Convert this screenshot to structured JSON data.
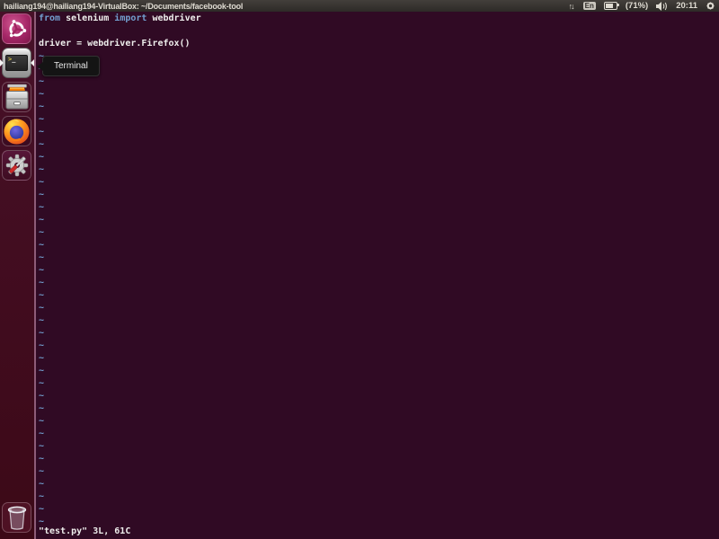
{
  "panel": {
    "title": "hailiang194@hailiang194-VirtualBox: ~/Documents/facebook-tool",
    "keyboard_layout": "En",
    "battery_percent": "(71%)",
    "clock": "20:11",
    "network_icon": "updown-arrows-icon",
    "battery_icon": "battery-icon",
    "volume_icon": "speaker-icon",
    "session_icon": "gear-icon"
  },
  "launcher": {
    "items": [
      {
        "name": "ubuntu-dash",
        "icon": "ubuntu-logo-icon"
      },
      {
        "name": "terminal",
        "icon": "terminal-icon",
        "running": true,
        "focused": true
      },
      {
        "name": "files",
        "icon": "file-cabinet-icon"
      },
      {
        "name": "firefox",
        "icon": "firefox-icon"
      },
      {
        "name": "settings",
        "icon": "gear-tools-icon"
      },
      {
        "name": "trash",
        "icon": "trash-icon"
      }
    ]
  },
  "tooltip": {
    "text": "Terminal"
  },
  "terminal": {
    "line1_tokens": [
      {
        "text": "from ",
        "type": "keyword"
      },
      {
        "text": "selenium ",
        "type": "plain"
      },
      {
        "text": "import ",
        "type": "keyword"
      },
      {
        "text": "webdriver",
        "type": "plain"
      }
    ],
    "line2": "",
    "line3": "driver = webdriver.Firefox()",
    "tilde": "~",
    "tilde_count": 38,
    "status_line": "\"test.py\" 3L, 61C"
  },
  "colors": {
    "terminal_bg": "#300a24",
    "keyword": "#729fcf",
    "plain_text": "#eeeeec",
    "tilde": "#729fcf",
    "panel_bg": "#38342f",
    "panel_fg": "#dfdbd2",
    "launcher_bg": "#420b1c",
    "ubuntu_tile": "#a52767",
    "tooltip_bg": "#141414"
  }
}
